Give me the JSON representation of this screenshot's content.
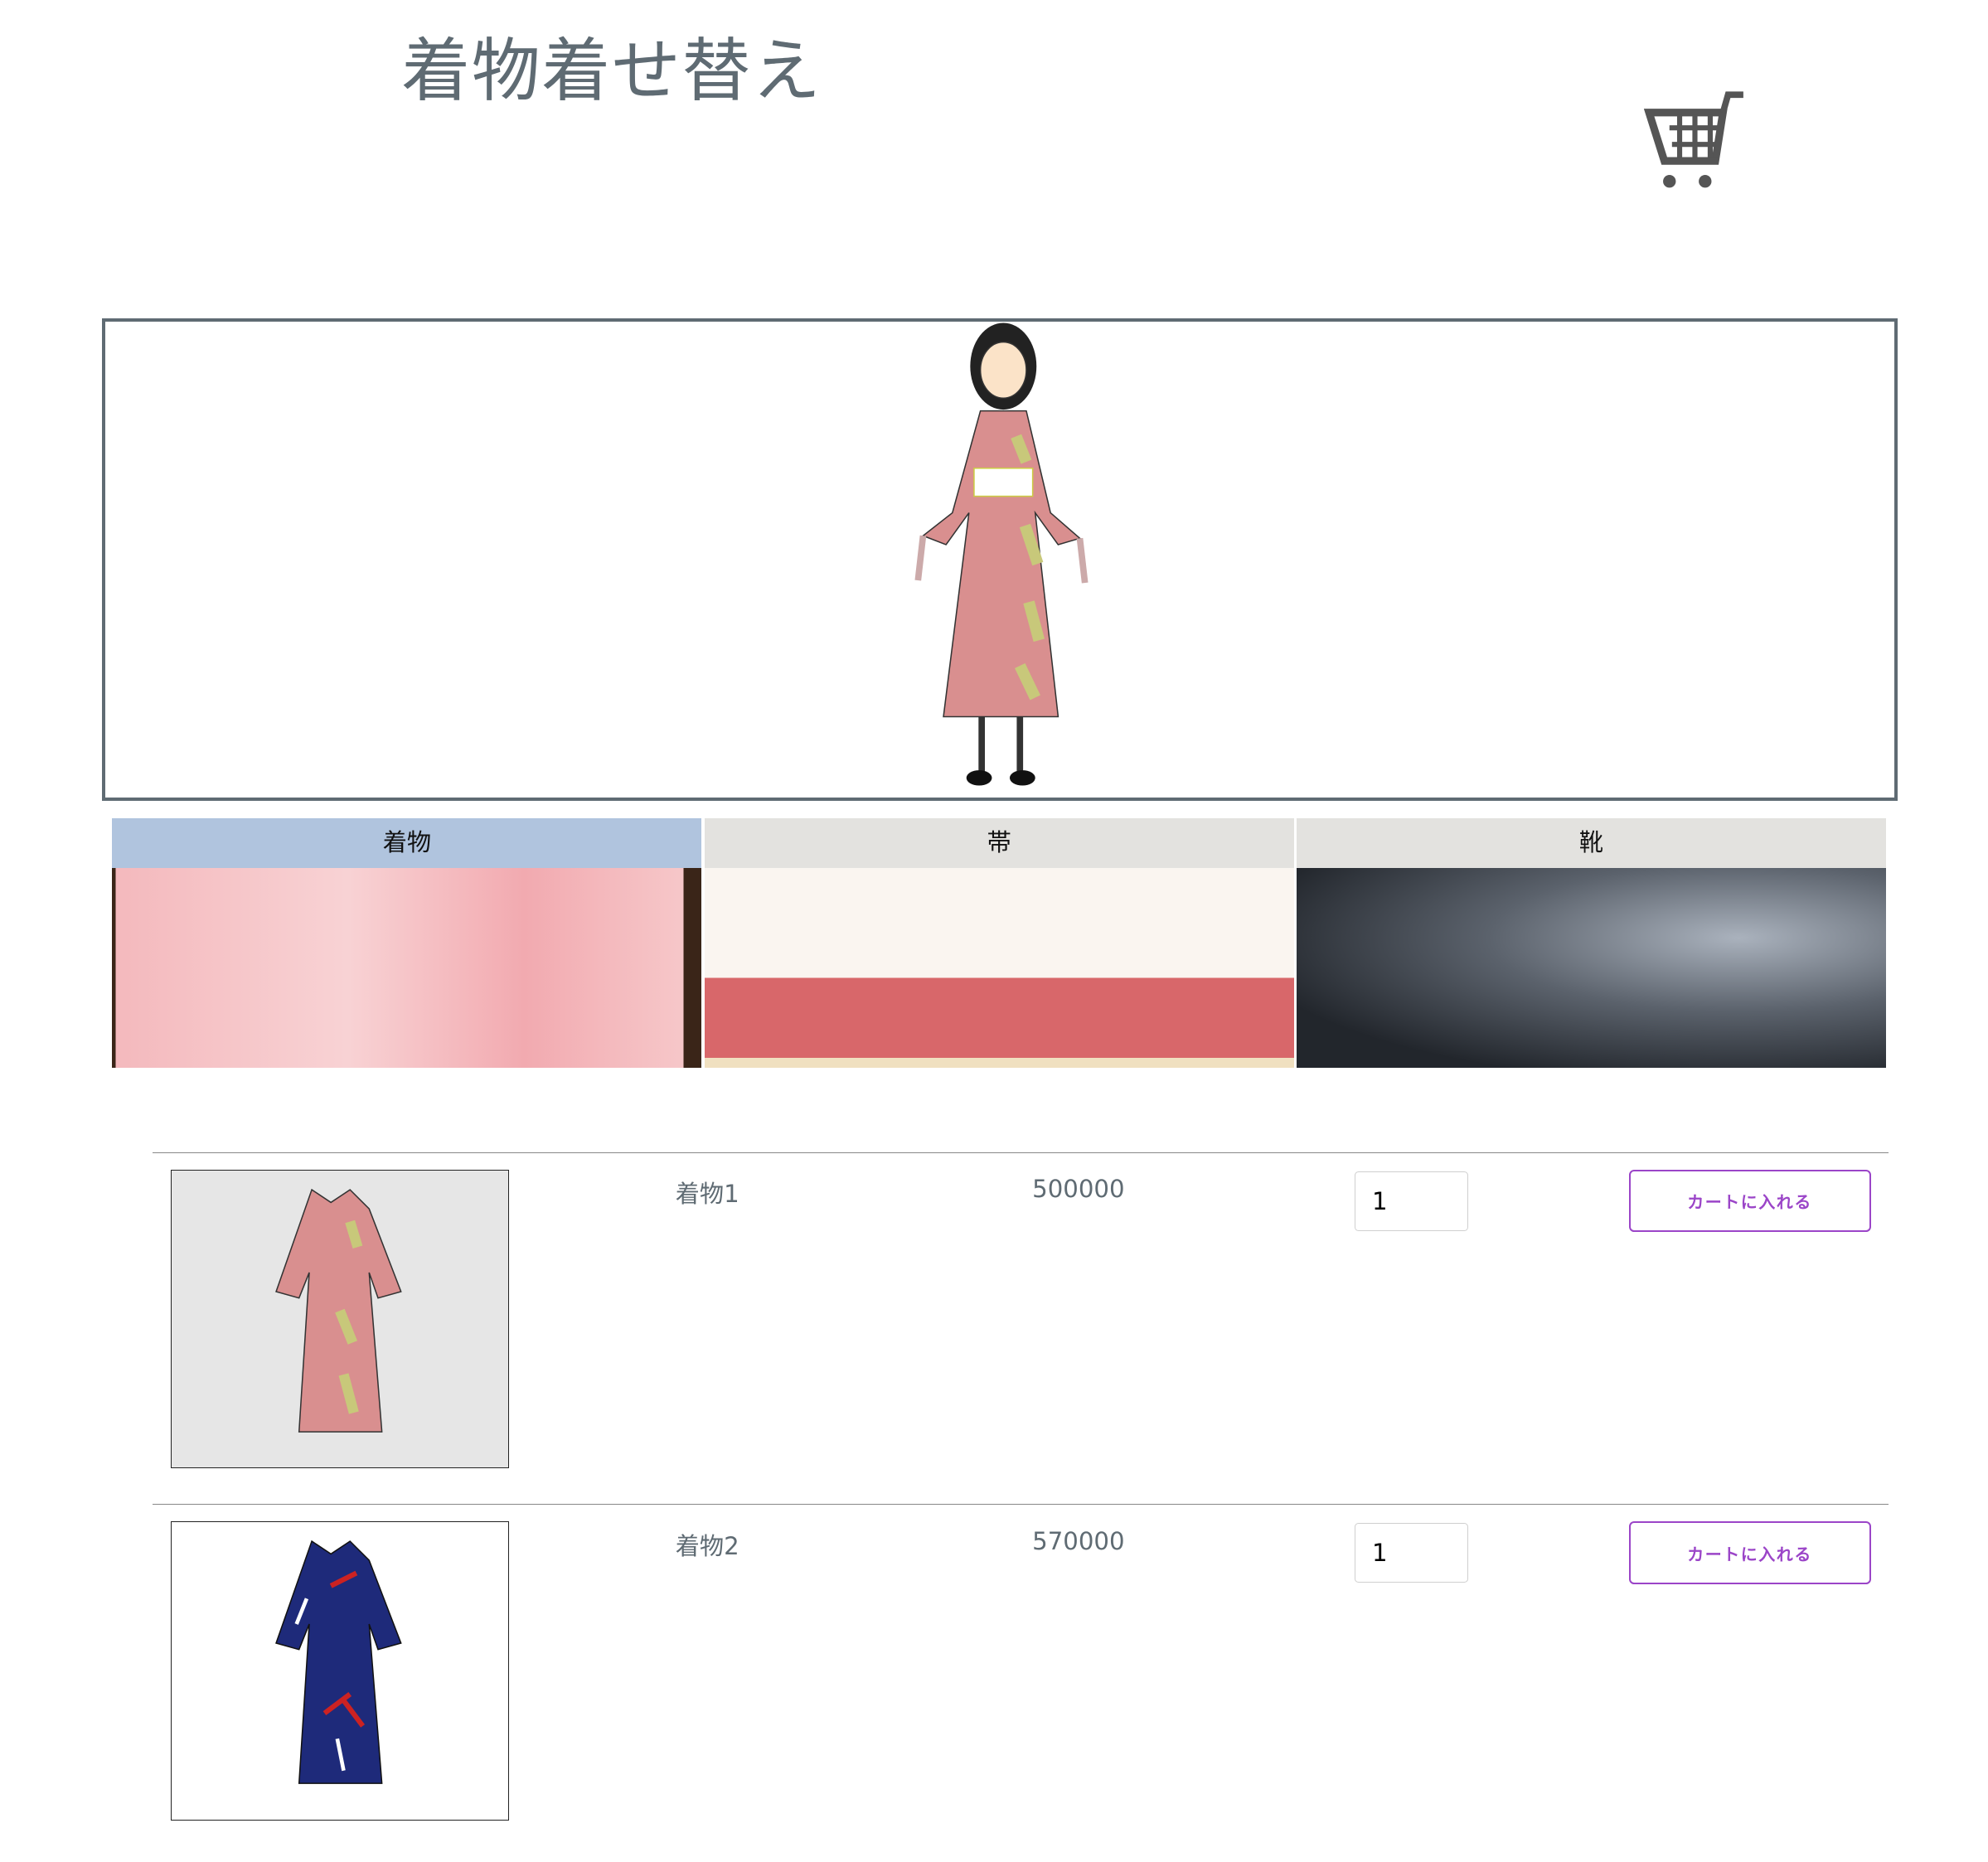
{
  "header": {
    "title": "着物着せ替え",
    "cart_icon": "shopping-cart-icon"
  },
  "tabs": [
    {
      "label": "着物",
      "active": true
    },
    {
      "label": "帯",
      "active": false
    },
    {
      "label": "靴",
      "active": false
    }
  ],
  "colors": {
    "title": "#5f6b73",
    "active_tab": "#b0c4de",
    "tab": "#e3e2df",
    "button": "#9b45c8",
    "kimono1": "#d98f8f",
    "kimono2": "#1e2a7a"
  },
  "products": [
    {
      "name": "着物1",
      "price": "500000",
      "quantity": "1",
      "button": "カートに入れる"
    },
    {
      "name": "着物2",
      "price": "570000",
      "quantity": "1",
      "button": "カートに入れる"
    }
  ]
}
